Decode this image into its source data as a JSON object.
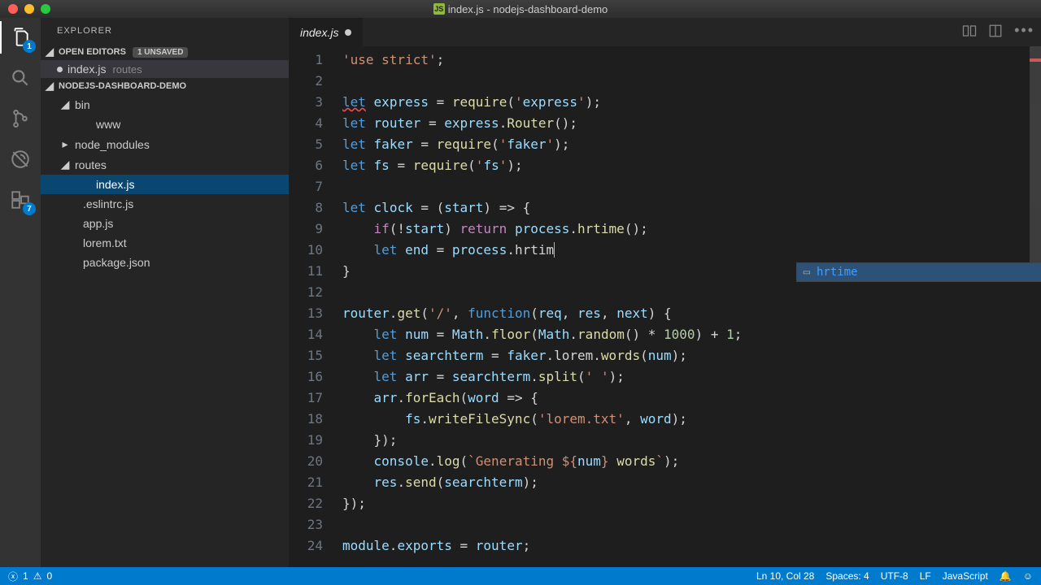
{
  "window": {
    "title": "index.js - nodejs-dashboard-demo"
  },
  "activity": {
    "explorer_badge": "1",
    "extensions_badge": "7"
  },
  "sidebar": {
    "title": "EXPLORER",
    "open_editors_label": "OPEN EDITORS",
    "unsaved_badge": "1 UNSAVED",
    "open_editor_file": "index.js",
    "open_editor_path": "routes",
    "project_name": "NODEJS-DASHBOARD-DEMO",
    "tree": [
      {
        "label": "bin",
        "indent": 24,
        "chev": "◢"
      },
      {
        "label": "www",
        "indent": 50,
        "chev": ""
      },
      {
        "label": "node_modules",
        "indent": 24,
        "chev": "▸"
      },
      {
        "label": "routes",
        "indent": 24,
        "chev": "◢"
      },
      {
        "label": "index.js",
        "indent": 50,
        "chev": "",
        "sel": true
      },
      {
        "label": ".eslintrc.js",
        "indent": 34,
        "chev": ""
      },
      {
        "label": "app.js",
        "indent": 34,
        "chev": ""
      },
      {
        "label": "lorem.txt",
        "indent": 34,
        "chev": ""
      },
      {
        "label": "package.json",
        "indent": 34,
        "chev": ""
      }
    ]
  },
  "tab": {
    "label": "index.js"
  },
  "suggest": {
    "item": "hrtime"
  },
  "code": {
    "lines": [
      "'use strict';",
      "",
      "let express = require('express');",
      "let router = express.Router();",
      "let faker = require('faker');",
      "let fs = require('fs');",
      "",
      "let clock = (start) => {",
      "    if(!start) return process.hrtime();",
      "    let end = process.hrtim",
      "}",
      "",
      "router.get('/', function(req, res, next) {",
      "    let num = Math.floor(Math.random() * 1000) + 1;",
      "    let searchterm = faker.lorem.words(num);",
      "    let arr = searchterm.split(' ');",
      "    arr.forEach(word => {",
      "        fs.writeFileSync('lorem.txt', word);",
      "    });",
      "    console.log(`Generating ${num} words`);",
      "    res.send(searchterm);",
      "});",
      "",
      "module.exports = router;"
    ]
  },
  "status": {
    "errors": "1",
    "warnings": "0",
    "lncol": "Ln 10, Col 28",
    "spaces": "Spaces: 4",
    "encoding": "UTF-8",
    "eol": "LF",
    "lang": "JavaScript"
  }
}
